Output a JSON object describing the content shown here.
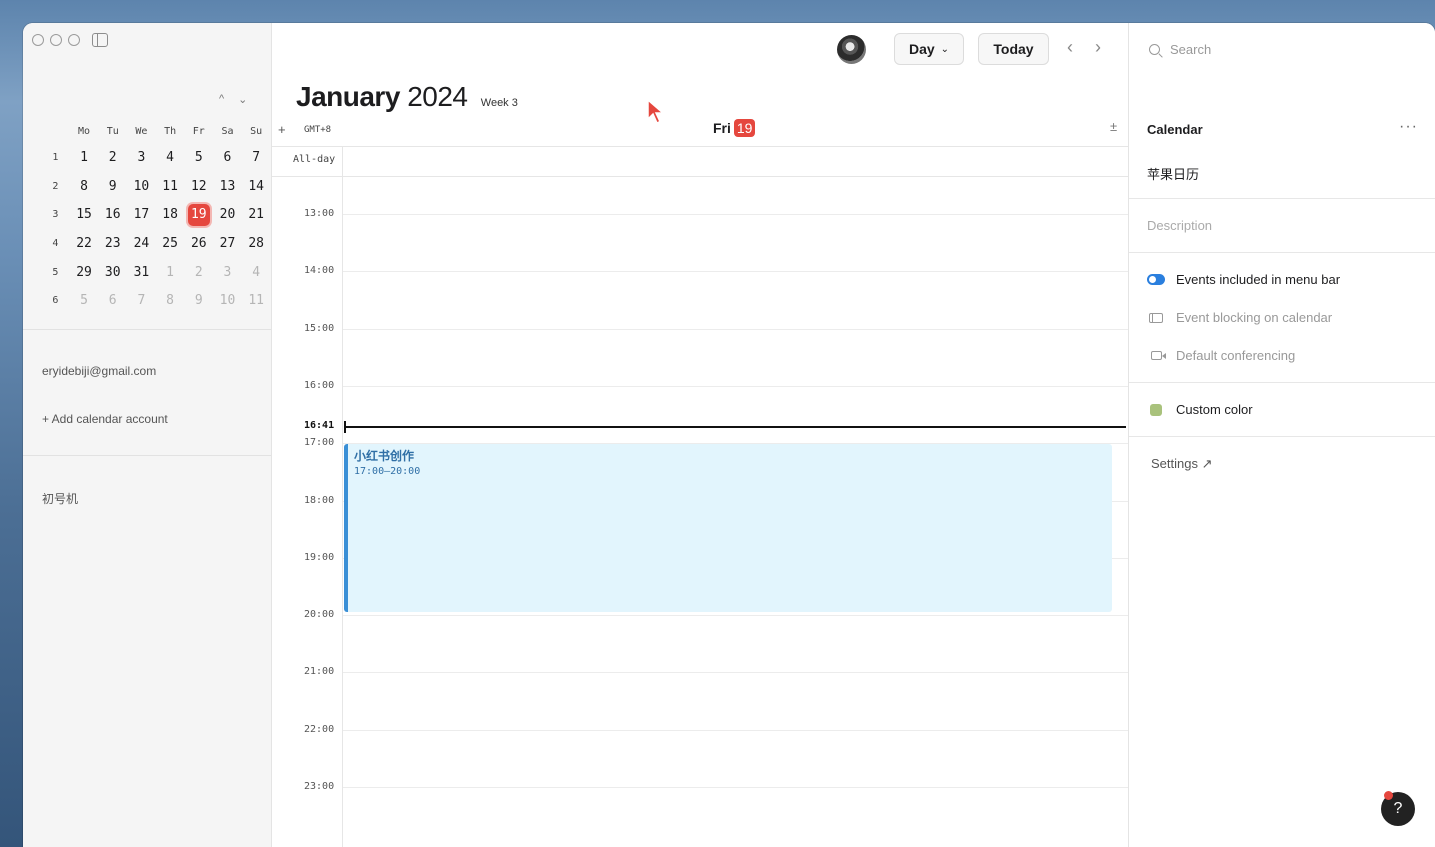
{
  "sidebar": {
    "mini_cal": {
      "weekdays": [
        "Mo",
        "Tu",
        "We",
        "Th",
        "Fr",
        "Sa",
        "Su"
      ],
      "weeks": [
        {
          "wk": "1",
          "days": [
            "1",
            "2",
            "3",
            "4",
            "5",
            "6",
            "7"
          ]
        },
        {
          "wk": "2",
          "days": [
            "8",
            "9",
            "10",
            "11",
            "12",
            "13",
            "14"
          ]
        },
        {
          "wk": "3",
          "days": [
            "15",
            "16",
            "17",
            "18",
            "19",
            "20",
            "21"
          ]
        },
        {
          "wk": "4",
          "days": [
            "22",
            "23",
            "24",
            "25",
            "26",
            "27",
            "28"
          ]
        },
        {
          "wk": "5",
          "days": [
            "29",
            "30",
            "31",
            "1",
            "2",
            "3",
            "4"
          ]
        },
        {
          "wk": "6",
          "days": [
            "5",
            "6",
            "7",
            "8",
            "9",
            "10",
            "11"
          ]
        }
      ],
      "today": "19",
      "nav_up": "^",
      "nav_down": "⌄"
    },
    "account_email": "eryidebiji@gmail.com",
    "add_account": "+ Add calendar account",
    "calendar_group": "初号机"
  },
  "toolbar": {
    "view_label": "Day",
    "today_label": "Today",
    "prev": "‹",
    "next": "›"
  },
  "header": {
    "month": "January",
    "year": "2024",
    "week": "Week 3",
    "timezone": "GMT+8",
    "plus": "+",
    "collapse": "±",
    "day_name": "Fri",
    "day_num": "19",
    "allday": "All-day"
  },
  "timeline": {
    "hours": [
      "13:00",
      "14:00",
      "15:00",
      "16:00",
      "17:00",
      "18:00",
      "19:00",
      "20:00",
      "21:00",
      "22:00",
      "23:00"
    ],
    "now": "16:41"
  },
  "event": {
    "title": "小红书创作",
    "time": "17:00–20:00",
    "color": "#3a8fd6"
  },
  "right_panel": {
    "search_placeholder": "Search",
    "section_title": "Calendar",
    "more": "···",
    "calendar_name": "苹果日历",
    "description_placeholder": "Description",
    "menu_bar": "Events included in menu bar",
    "blocking": "Event blocking on calendar",
    "conferencing": "Default conferencing",
    "custom_color": "Custom color",
    "custom_color_value": "#a9c27c",
    "settings": "Settings ↗",
    "help": "?"
  },
  "colors": {
    "accent_red": "#e5473e",
    "accent_blue": "#2a7fde"
  }
}
